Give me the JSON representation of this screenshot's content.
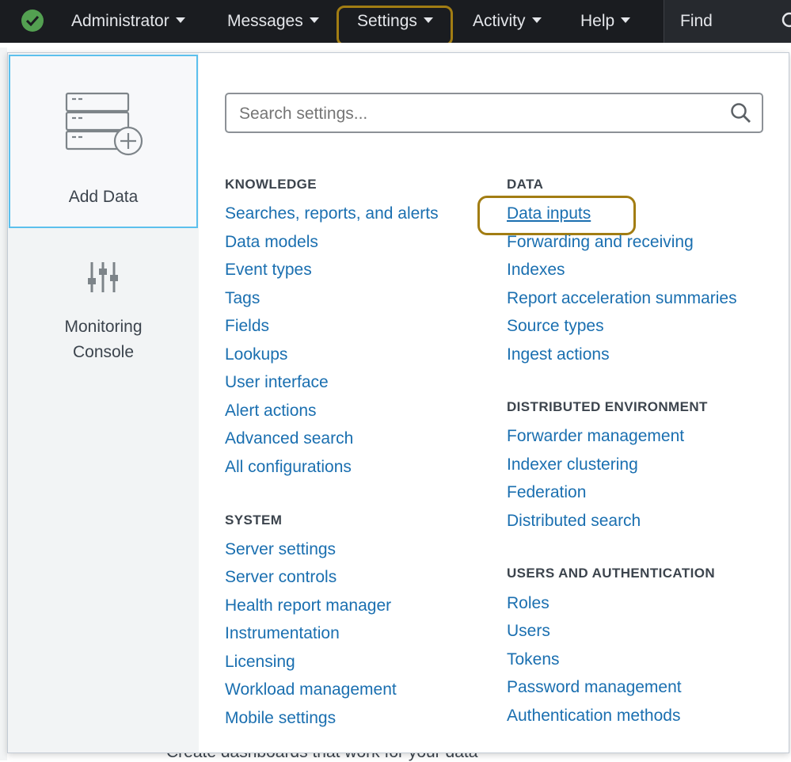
{
  "topbar": {
    "status_icon": "check-circle-icon",
    "nav": [
      "Administrator",
      "Messages",
      "Settings",
      "Activity",
      "Help"
    ],
    "find_label": "Find",
    "find_icon": "search-icon"
  },
  "background": {
    "partial_text": "Create dashboards that work for your data"
  },
  "sidebar": {
    "add_data_label": "Add Data",
    "add_data_icon": "server-add-icon",
    "monitoring_label_1": "Monitoring",
    "monitoring_label_2": "Console",
    "monitoring_icon": "sliders-icon"
  },
  "search": {
    "placeholder": "Search settings...",
    "icon": "search-icon"
  },
  "knowledge": {
    "title": "KNOWLEDGE",
    "links": [
      "Searches, reports, and alerts",
      "Data models",
      "Event types",
      "Tags",
      "Fields",
      "Lookups",
      "User interface",
      "Alert actions",
      "Advanced search",
      "All configurations"
    ]
  },
  "system": {
    "title": "SYSTEM",
    "links": [
      "Server settings",
      "Server controls",
      "Health report manager",
      "Instrumentation",
      "Licensing",
      "Workload management",
      "Mobile settings"
    ]
  },
  "data": {
    "title": "DATA",
    "links": [
      "Data inputs",
      "Forwarding and receiving",
      "Indexes",
      "Report acceleration summaries",
      "Source types",
      "Ingest actions"
    ]
  },
  "distributed": {
    "title": "DISTRIBUTED ENVIRONMENT",
    "links": [
      "Forwarder management",
      "Indexer clustering",
      "Federation",
      "Distributed search"
    ]
  },
  "users": {
    "title": "USERS AND AUTHENTICATION",
    "links": [
      "Roles",
      "Users",
      "Tokens",
      "Password management",
      "Authentication methods"
    ]
  },
  "colors": {
    "topbar_bg": "#1a1c20",
    "link": "#1a6fb0",
    "highlight": "#a27d13",
    "status_ok": "#53a051",
    "tile_border": "#5cc0ed"
  }
}
